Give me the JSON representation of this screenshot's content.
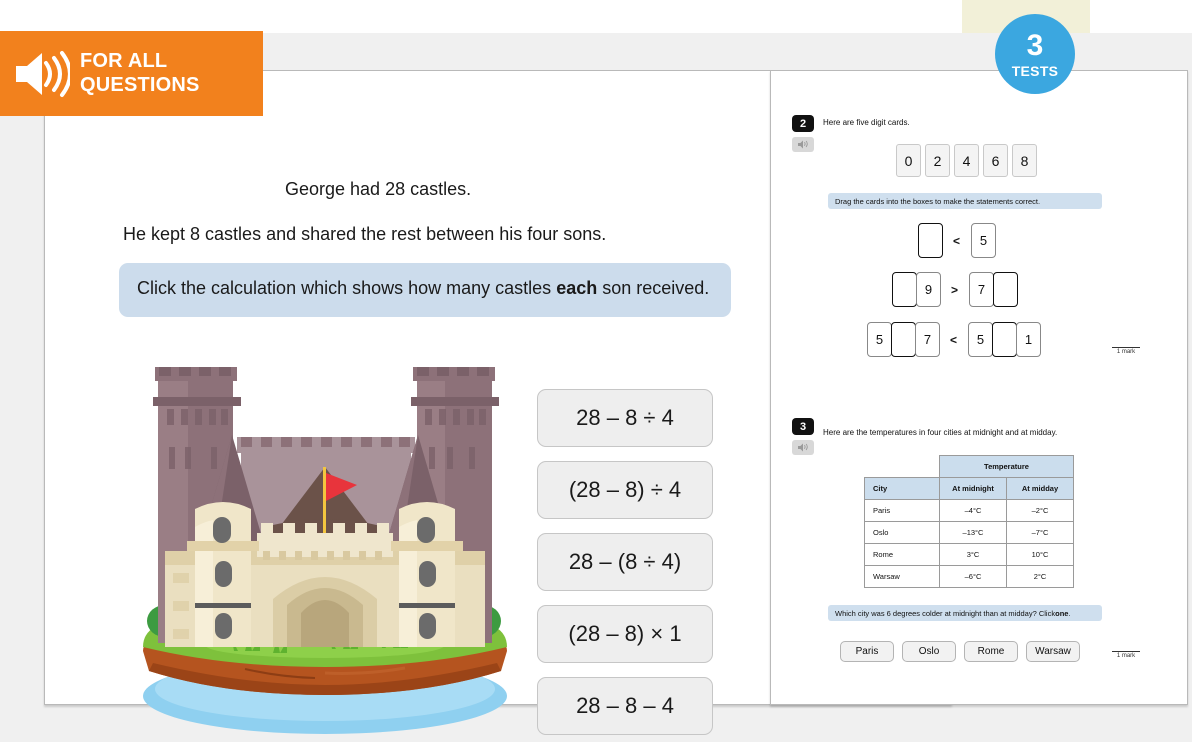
{
  "audio_banner": {
    "icon": "speaker-icon",
    "line1": "FOR ALL",
    "line2": "QUESTIONS",
    "color": "#f2811d"
  },
  "tests_badge": {
    "number": "3",
    "label": "TESTS",
    "color": "#3ba7e0"
  },
  "left_panel": {
    "question_line_1": "George had 28 castles.",
    "question_line_2": "He kept 8 castles and shared the rest between his four sons.",
    "instruction_prefix": "Click the calculation which shows how many castles ",
    "instruction_bold": "each",
    "instruction_suffix": " son received.",
    "illustration": "castle-illustration",
    "options": [
      "28 – 8 ÷ 4",
      "(28 – 8) ÷ 4",
      "28 – (8 ÷ 4)",
      "(28 – 8) × 1",
      "28 – 8 – 4"
    ]
  },
  "right_panel": {
    "question2": {
      "number": "2",
      "stem": "Here are five digit cards.",
      "digit_cards": [
        "0",
        "2",
        "4",
        "6",
        "8"
      ],
      "drag_instruction": "Drag the cards into the boxes to make the statements correct.",
      "statements": [
        {
          "left": [
            {
              "type": "blank"
            }
          ],
          "operator": "<",
          "right": [
            {
              "type": "given",
              "value": "5"
            }
          ]
        },
        {
          "left": [
            {
              "type": "blank"
            },
            {
              "type": "given",
              "value": "9"
            }
          ],
          "operator": ">",
          "right": [
            {
              "type": "given",
              "value": "7"
            },
            {
              "type": "blank"
            }
          ]
        },
        {
          "left": [
            {
              "type": "given",
              "value": "5"
            },
            {
              "type": "blank"
            },
            {
              "type": "given",
              "value": "7"
            }
          ],
          "operator": "<",
          "right": [
            {
              "type": "given",
              "value": "5"
            },
            {
              "type": "blank"
            },
            {
              "type": "given",
              "value": "1"
            }
          ]
        }
      ],
      "mark": "1 mark"
    },
    "question3": {
      "number": "3",
      "stem": "Here are the temperatures in four cities at midnight and at midday.",
      "table": {
        "group_header": "Temperature",
        "headers": [
          "City",
          "At midnight",
          "At midday"
        ],
        "rows": [
          [
            "Paris",
            "–4°C",
            "–2°C"
          ],
          [
            "Oslo",
            "–13°C",
            "–7°C"
          ],
          [
            "Rome",
            "3°C",
            "10°C"
          ],
          [
            "Warsaw",
            "–6°C",
            "2°C"
          ]
        ]
      },
      "question_prefix": "Which city was 6 degrees colder at midnight than at midday? Click ",
      "question_bold": "one",
      "question_suffix": ".",
      "city_buttons": [
        "Paris",
        "Oslo",
        "Rome",
        "Warsaw"
      ],
      "mark": "1 mark"
    }
  }
}
